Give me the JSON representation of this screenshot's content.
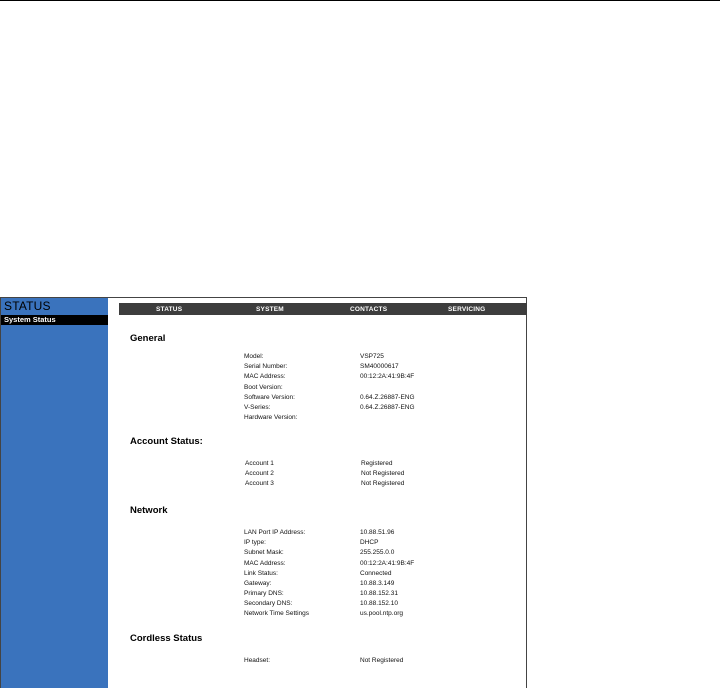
{
  "sidebar": {
    "title": "STATUS",
    "items": [
      {
        "label": "System Status"
      }
    ]
  },
  "nav": {
    "tabs": [
      {
        "label": "STATUS"
      },
      {
        "label": "SYSTEM"
      },
      {
        "label": "CONTACTS"
      },
      {
        "label": "SERVICING"
      }
    ]
  },
  "general": {
    "title": "General",
    "rows": [
      {
        "label": "Model:",
        "value": "VSP725"
      },
      {
        "label": "Serial Number:",
        "value": "SM40000617"
      },
      {
        "label": "MAC Address:",
        "value": "00:12:2A:41:9B:4F"
      },
      {
        "label": "Boot Version:",
        "value": ""
      },
      {
        "label": "Software Version:",
        "value": "0.64.Z.26887-ENG"
      },
      {
        "label": "V-Series:",
        "value": "0.64.Z.26887-ENG"
      },
      {
        "label": "Hardware Version:",
        "value": ""
      }
    ]
  },
  "account": {
    "title": "Account Status:",
    "rows": [
      {
        "label": "Account 1",
        "value": "Registered"
      },
      {
        "label": "Account 2",
        "value": "Not Registered"
      },
      {
        "label": "Account 3",
        "value": "Not Registered"
      }
    ]
  },
  "network": {
    "title": "Network",
    "rows": [
      {
        "label": "LAN Port IP Address:",
        "value": "10.88.51.96"
      },
      {
        "label": "IP type:",
        "value": "DHCP"
      },
      {
        "label": "Subnet Mask:",
        "value": "255.255.0.0"
      },
      {
        "label": "MAC Address:",
        "value": "00:12:2A:41:9B:4F"
      },
      {
        "label": "Link Status:",
        "value": "Connected"
      },
      {
        "label": "Gateway:",
        "value": "10.88.3.149"
      },
      {
        "label": "Primary DNS:",
        "value": "10.88.152.31"
      },
      {
        "label": "Secondary DNS:",
        "value": "10.88.152.10"
      },
      {
        "label": "Network Time Settings",
        "value": "us.pool.ntp.org"
      }
    ]
  },
  "cordless": {
    "title": "Cordless Status",
    "rows": [
      {
        "label": "Headset:",
        "value": "Not Registered"
      }
    ]
  }
}
